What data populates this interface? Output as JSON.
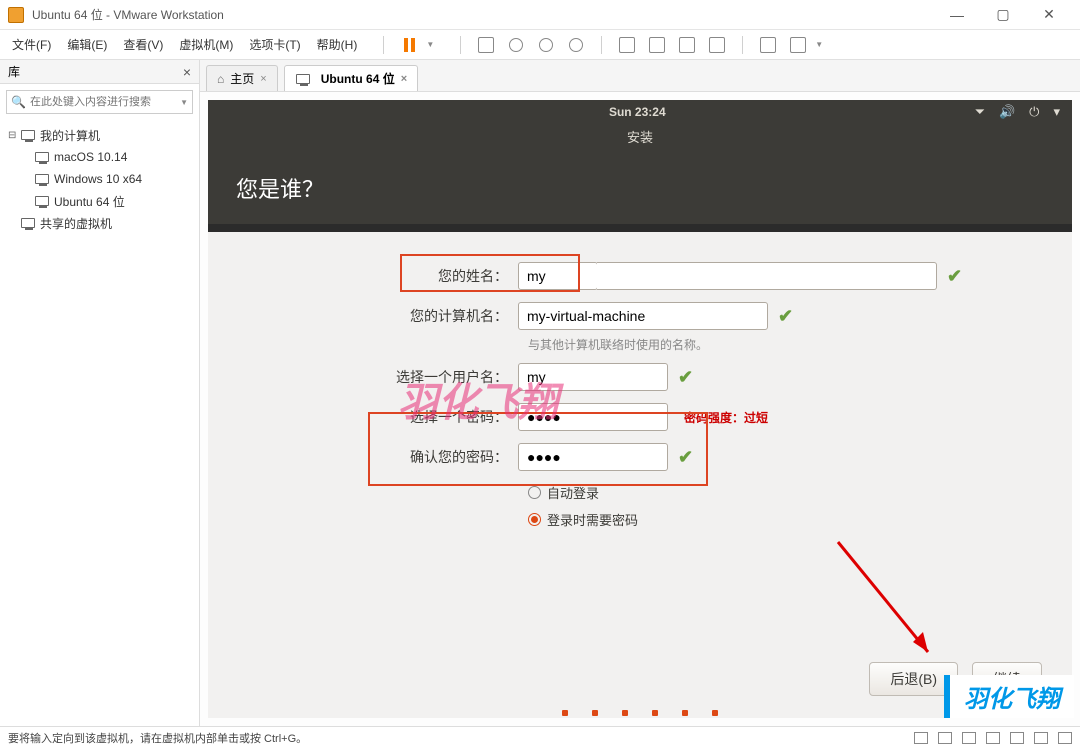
{
  "window": {
    "title": "Ubuntu 64 位 - VMware Workstation"
  },
  "menu": {
    "file": "文件(F)",
    "edit": "编辑(E)",
    "view": "查看(V)",
    "vm": "虚拟机(M)",
    "tabs": "选项卡(T)",
    "help": "帮助(H)"
  },
  "sidebar": {
    "title": "库",
    "search_placeholder": "在此处键入内容进行搜索",
    "root": "我的计算机",
    "items": [
      "macOS 10.14",
      "Windows 10 x64",
      "Ubuntu 64 位"
    ],
    "shared": "共享的虚拟机"
  },
  "tabs": {
    "home": "主页",
    "vm": "Ubuntu 64 位"
  },
  "ubuntu": {
    "clock": "Sun 23:24",
    "install_title": "安装",
    "heading": "您是谁？",
    "labels": {
      "name": "您的姓名：",
      "computer": "您的计算机名：",
      "computer_hint": "与其他计算机联络时使用的名称。",
      "username": "选择一个用户名：",
      "password": "选择一个密码：",
      "confirm": "确认您的密码：",
      "strength": "密码强度：过短",
      "auto_login": "自动登录",
      "require_pwd": "登录时需要密码"
    },
    "values": {
      "name": "my",
      "computer": "my-virtual-machine",
      "username": "my",
      "password": "●●●●",
      "confirm": "●●●●"
    },
    "buttons": {
      "back": "后退(B)",
      "continue": "继续"
    }
  },
  "watermark": "羽化飞翔",
  "logo": "羽化飞翔",
  "statusbar": {
    "text": "要将输入定向到该虚拟机，请在虚拟机内部单击或按 Ctrl+G。"
  }
}
